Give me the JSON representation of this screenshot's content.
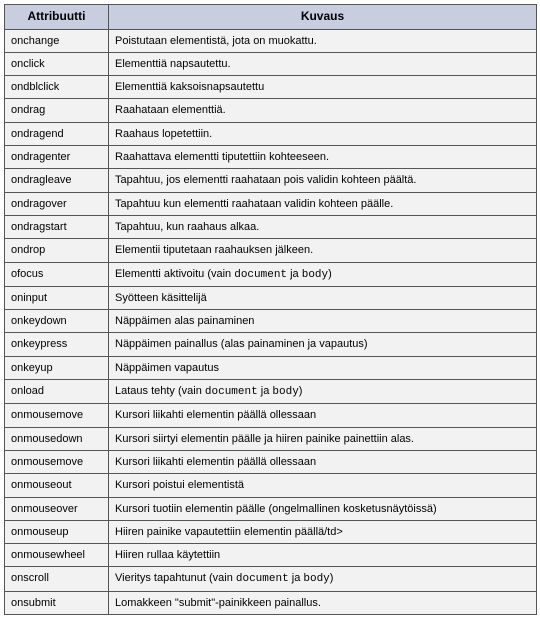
{
  "headers": {
    "attr": "Attribuutti",
    "desc": "Kuvaus"
  },
  "code_fragment": {
    "document": "document",
    "body": "body"
  },
  "rows": [
    {
      "attr": "onchange",
      "desc": "Poistutaan elementistä, jota on muokattu."
    },
    {
      "attr": "onclick",
      "desc": "Elementtiä napsautettu."
    },
    {
      "attr": "ondblclick",
      "desc": "Elementtiä kaksoisnapsautettu"
    },
    {
      "attr": "ondrag",
      "desc": "Raahataan elementtiä."
    },
    {
      "attr": "ondragend",
      "desc": "Raahaus lopetettiin."
    },
    {
      "attr": "ondragenter",
      "desc": "Raahattava elementti tiputettiin kohteeseen."
    },
    {
      "attr": "ondragleave",
      "desc": "Tapahtuu, jos elementti raahataan pois validin kohteen päältä."
    },
    {
      "attr": "ondragover",
      "desc": "Tapahtuu kun elementti raahataan validin kohteen päälle."
    },
    {
      "attr": "ondragstart",
      "desc": "Tapahtuu, kun raahaus alkaa."
    },
    {
      "attr": "ondrop",
      "desc": "Elementii tiputetaan raahauksen jälkeen."
    },
    {
      "attr": "ofocus",
      "desc_pre": "Elementti aktivoitu (vain ",
      "desc_mid": " ja ",
      "desc_post": ")",
      "code": true
    },
    {
      "attr": "oninput",
      "desc": "Syötteen käsittelijä"
    },
    {
      "attr": "onkeydown",
      "desc": "Näppäimen alas painaminen"
    },
    {
      "attr": "onkeypress",
      "desc": "Näppäimen painallus (alas painaminen ja vapautus)"
    },
    {
      "attr": "onkeyup",
      "desc": "Näppäimen vapautus"
    },
    {
      "attr": "onload",
      "desc_pre": "Lataus tehty (vain ",
      "desc_mid": " ja ",
      "desc_post": ")",
      "code": true
    },
    {
      "attr": "onmousemove",
      "desc": "Kursori liikahti elementin päällä ollessaan"
    },
    {
      "attr": "onmousedown",
      "desc": "Kursori siirtyi elementin päälle ja hiiren painike painettiin alas."
    },
    {
      "attr": "onmousemove",
      "desc": "Kursori liikahti elementin päällä ollessaan"
    },
    {
      "attr": "onmouseout",
      "desc": "Kursori poistui elementistä"
    },
    {
      "attr": "onmouseover",
      "desc": "Kursori tuotiin elementin päälle (ongelmallinen kosketusnäytöissä)"
    },
    {
      "attr": "onmouseup",
      "desc": "Hiiren painike vapautettiin elementin päällä/td>"
    },
    {
      "attr": "onmousewheel",
      "desc": "Hiiren rullaa käytettiin"
    },
    {
      "attr": "onscroll",
      "desc_pre": "Vieritys tapahtunut (vain ",
      "desc_mid": " ja ",
      "desc_post": ")",
      "code": true
    },
    {
      "attr": "onsubmit",
      "desc": "Lomakkeen \"submit\"-painikkeen painallus."
    }
  ]
}
